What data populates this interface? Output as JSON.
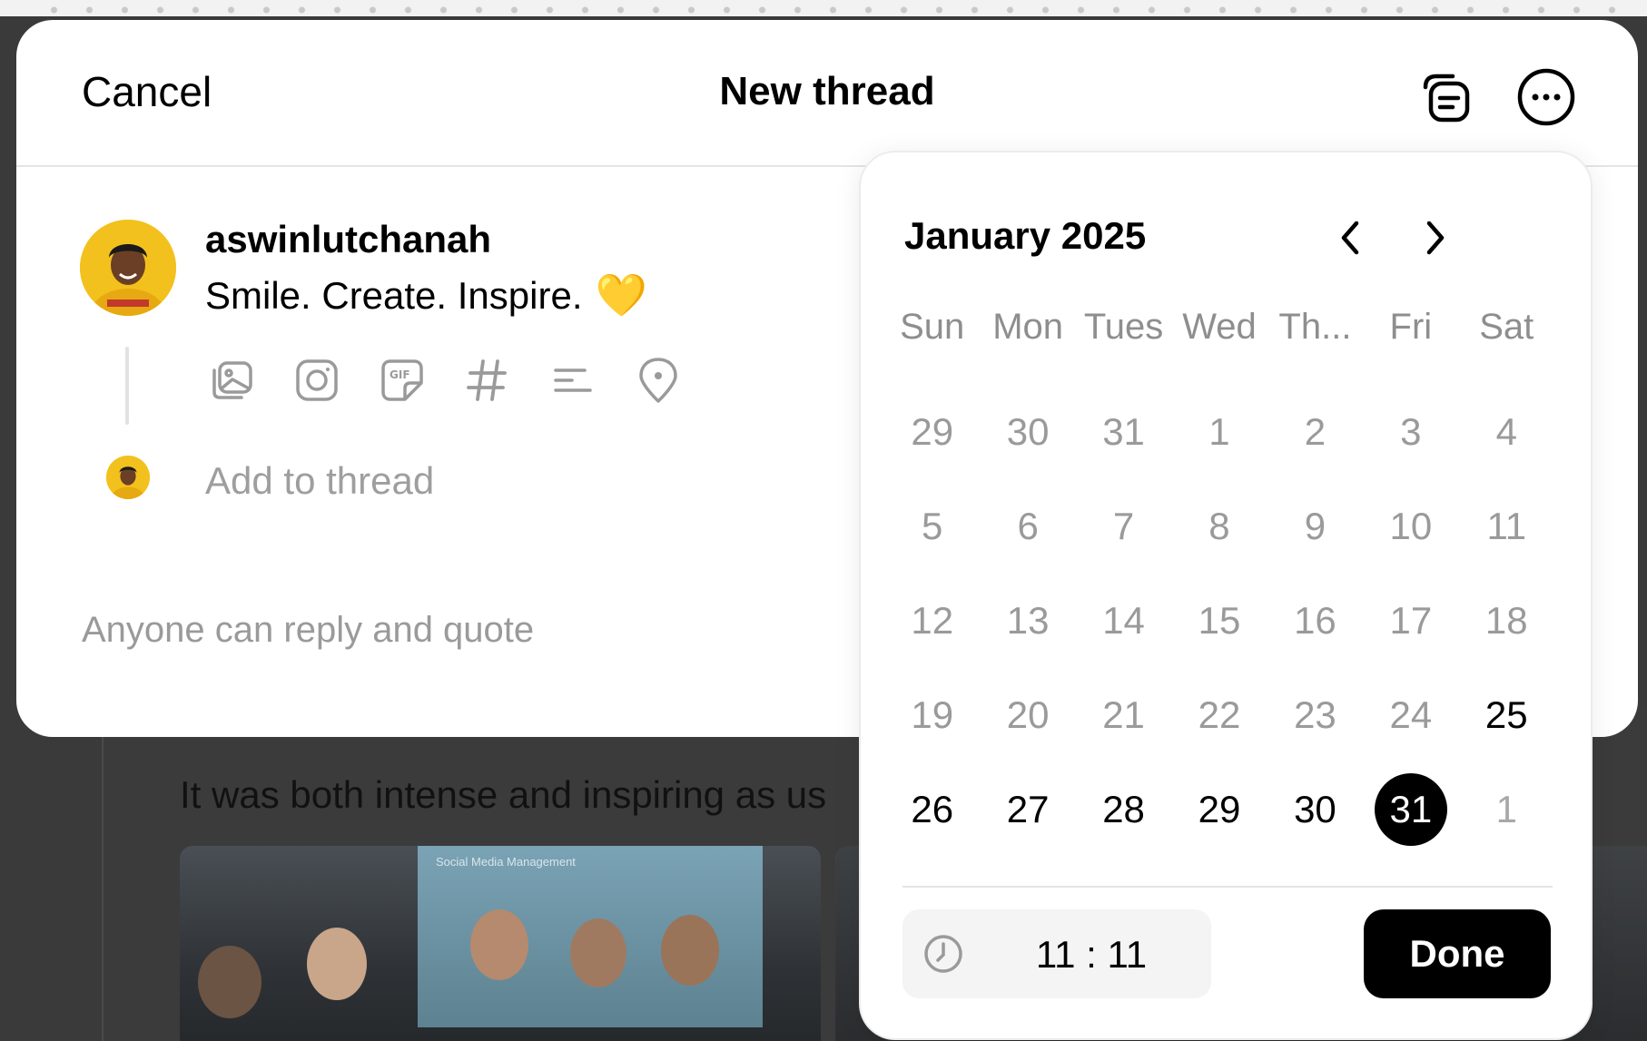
{
  "header": {
    "cancel_label": "Cancel",
    "title": "New thread",
    "drafts_icon": "drafts-icon",
    "more_icon": "more-options-icon"
  },
  "post": {
    "username": "aswinlutchanah",
    "text": "Smile. Create. Inspire.",
    "emoji": "💛",
    "tools": [
      "gallery-icon",
      "camera-icon",
      "gif-icon",
      "hashtag-icon",
      "poll-icon",
      "location-icon"
    ],
    "add_to_thread": "Add to thread",
    "reply_setting": "Anyone can reply and quote"
  },
  "background": {
    "post_text": "It was both intense and inspiring as us",
    "screen_label": "Social Media Management"
  },
  "calendar": {
    "month_label": "January 2025",
    "prev_icon": "chevron-left-icon",
    "next_icon": "chevron-right-icon",
    "weekdays": [
      "Sun",
      "Mon",
      "Tues",
      "Wed",
      "Th...",
      "Fri",
      "Sat"
    ],
    "days": [
      {
        "label": "29",
        "state": "disabled"
      },
      {
        "label": "30",
        "state": "disabled"
      },
      {
        "label": "31",
        "state": "disabled"
      },
      {
        "label": "1",
        "state": "disabled"
      },
      {
        "label": "2",
        "state": "disabled"
      },
      {
        "label": "3",
        "state": "disabled"
      },
      {
        "label": "4",
        "state": "disabled"
      },
      {
        "label": "5",
        "state": "disabled"
      },
      {
        "label": "6",
        "state": "disabled"
      },
      {
        "label": "7",
        "state": "disabled"
      },
      {
        "label": "8",
        "state": "disabled"
      },
      {
        "label": "9",
        "state": "disabled"
      },
      {
        "label": "10",
        "state": "disabled"
      },
      {
        "label": "11",
        "state": "disabled"
      },
      {
        "label": "12",
        "state": "disabled"
      },
      {
        "label": "13",
        "state": "disabled"
      },
      {
        "label": "14",
        "state": "disabled"
      },
      {
        "label": "15",
        "state": "disabled"
      },
      {
        "label": "16",
        "state": "disabled"
      },
      {
        "label": "17",
        "state": "disabled"
      },
      {
        "label": "18",
        "state": "disabled"
      },
      {
        "label": "19",
        "state": "disabled"
      },
      {
        "label": "20",
        "state": "disabled"
      },
      {
        "label": "21",
        "state": "disabled"
      },
      {
        "label": "22",
        "state": "disabled"
      },
      {
        "label": "23",
        "state": "disabled"
      },
      {
        "label": "24",
        "state": "disabled"
      },
      {
        "label": "25",
        "state": "active"
      },
      {
        "label": "26",
        "state": "active"
      },
      {
        "label": "27",
        "state": "active"
      },
      {
        "label": "28",
        "state": "active"
      },
      {
        "label": "29",
        "state": "active"
      },
      {
        "label": "30",
        "state": "active"
      },
      {
        "label": "31",
        "state": "selected"
      },
      {
        "label": "1",
        "state": "outside"
      }
    ],
    "time_icon": "clock-icon",
    "time_value": "11 : 11",
    "done_label": "Done"
  },
  "colors": {
    "backdrop": "#3a3a3a",
    "selected_day": "#000000",
    "muted_text": "#9a9a9a",
    "avatar_bg": "#f3c11d"
  }
}
